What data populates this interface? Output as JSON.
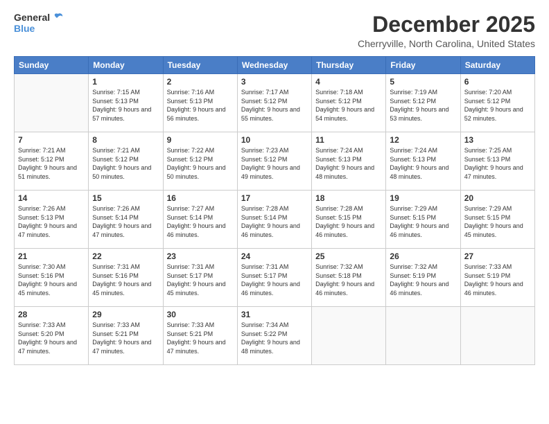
{
  "logo": {
    "general": "General",
    "blue": "Blue"
  },
  "title": {
    "month": "December 2025",
    "location": "Cherryville, North Carolina, United States"
  },
  "calendar": {
    "headers": [
      "Sunday",
      "Monday",
      "Tuesday",
      "Wednesday",
      "Thursday",
      "Friday",
      "Saturday"
    ],
    "weeks": [
      [
        {
          "day": "",
          "sunrise": "",
          "sunset": "",
          "daylight": ""
        },
        {
          "day": "1",
          "sunrise": "Sunrise: 7:15 AM",
          "sunset": "Sunset: 5:13 PM",
          "daylight": "Daylight: 9 hours and 57 minutes."
        },
        {
          "day": "2",
          "sunrise": "Sunrise: 7:16 AM",
          "sunset": "Sunset: 5:13 PM",
          "daylight": "Daylight: 9 hours and 56 minutes."
        },
        {
          "day": "3",
          "sunrise": "Sunrise: 7:17 AM",
          "sunset": "Sunset: 5:12 PM",
          "daylight": "Daylight: 9 hours and 55 minutes."
        },
        {
          "day": "4",
          "sunrise": "Sunrise: 7:18 AM",
          "sunset": "Sunset: 5:12 PM",
          "daylight": "Daylight: 9 hours and 54 minutes."
        },
        {
          "day": "5",
          "sunrise": "Sunrise: 7:19 AM",
          "sunset": "Sunset: 5:12 PM",
          "daylight": "Daylight: 9 hours and 53 minutes."
        },
        {
          "day": "6",
          "sunrise": "Sunrise: 7:20 AM",
          "sunset": "Sunset: 5:12 PM",
          "daylight": "Daylight: 9 hours and 52 minutes."
        }
      ],
      [
        {
          "day": "7",
          "sunrise": "Sunrise: 7:21 AM",
          "sunset": "Sunset: 5:12 PM",
          "daylight": "Daylight: 9 hours and 51 minutes."
        },
        {
          "day": "8",
          "sunrise": "Sunrise: 7:21 AM",
          "sunset": "Sunset: 5:12 PM",
          "daylight": "Daylight: 9 hours and 50 minutes."
        },
        {
          "day": "9",
          "sunrise": "Sunrise: 7:22 AM",
          "sunset": "Sunset: 5:12 PM",
          "daylight": "Daylight: 9 hours and 50 minutes."
        },
        {
          "day": "10",
          "sunrise": "Sunrise: 7:23 AM",
          "sunset": "Sunset: 5:12 PM",
          "daylight": "Daylight: 9 hours and 49 minutes."
        },
        {
          "day": "11",
          "sunrise": "Sunrise: 7:24 AM",
          "sunset": "Sunset: 5:13 PM",
          "daylight": "Daylight: 9 hours and 48 minutes."
        },
        {
          "day": "12",
          "sunrise": "Sunrise: 7:24 AM",
          "sunset": "Sunset: 5:13 PM",
          "daylight": "Daylight: 9 hours and 48 minutes."
        },
        {
          "day": "13",
          "sunrise": "Sunrise: 7:25 AM",
          "sunset": "Sunset: 5:13 PM",
          "daylight": "Daylight: 9 hours and 47 minutes."
        }
      ],
      [
        {
          "day": "14",
          "sunrise": "Sunrise: 7:26 AM",
          "sunset": "Sunset: 5:13 PM",
          "daylight": "Daylight: 9 hours and 47 minutes."
        },
        {
          "day": "15",
          "sunrise": "Sunrise: 7:26 AM",
          "sunset": "Sunset: 5:14 PM",
          "daylight": "Daylight: 9 hours and 47 minutes."
        },
        {
          "day": "16",
          "sunrise": "Sunrise: 7:27 AM",
          "sunset": "Sunset: 5:14 PM",
          "daylight": "Daylight: 9 hours and 46 minutes."
        },
        {
          "day": "17",
          "sunrise": "Sunrise: 7:28 AM",
          "sunset": "Sunset: 5:14 PM",
          "daylight": "Daylight: 9 hours and 46 minutes."
        },
        {
          "day": "18",
          "sunrise": "Sunrise: 7:28 AM",
          "sunset": "Sunset: 5:15 PM",
          "daylight": "Daylight: 9 hours and 46 minutes."
        },
        {
          "day": "19",
          "sunrise": "Sunrise: 7:29 AM",
          "sunset": "Sunset: 5:15 PM",
          "daylight": "Daylight: 9 hours and 46 minutes."
        },
        {
          "day": "20",
          "sunrise": "Sunrise: 7:29 AM",
          "sunset": "Sunset: 5:15 PM",
          "daylight": "Daylight: 9 hours and 45 minutes."
        }
      ],
      [
        {
          "day": "21",
          "sunrise": "Sunrise: 7:30 AM",
          "sunset": "Sunset: 5:16 PM",
          "daylight": "Daylight: 9 hours and 45 minutes."
        },
        {
          "day": "22",
          "sunrise": "Sunrise: 7:31 AM",
          "sunset": "Sunset: 5:16 PM",
          "daylight": "Daylight: 9 hours and 45 minutes."
        },
        {
          "day": "23",
          "sunrise": "Sunrise: 7:31 AM",
          "sunset": "Sunset: 5:17 PM",
          "daylight": "Daylight: 9 hours and 45 minutes."
        },
        {
          "day": "24",
          "sunrise": "Sunrise: 7:31 AM",
          "sunset": "Sunset: 5:17 PM",
          "daylight": "Daylight: 9 hours and 46 minutes."
        },
        {
          "day": "25",
          "sunrise": "Sunrise: 7:32 AM",
          "sunset": "Sunset: 5:18 PM",
          "daylight": "Daylight: 9 hours and 46 minutes."
        },
        {
          "day": "26",
          "sunrise": "Sunrise: 7:32 AM",
          "sunset": "Sunset: 5:19 PM",
          "daylight": "Daylight: 9 hours and 46 minutes."
        },
        {
          "day": "27",
          "sunrise": "Sunrise: 7:33 AM",
          "sunset": "Sunset: 5:19 PM",
          "daylight": "Daylight: 9 hours and 46 minutes."
        }
      ],
      [
        {
          "day": "28",
          "sunrise": "Sunrise: 7:33 AM",
          "sunset": "Sunset: 5:20 PM",
          "daylight": "Daylight: 9 hours and 47 minutes."
        },
        {
          "day": "29",
          "sunrise": "Sunrise: 7:33 AM",
          "sunset": "Sunset: 5:21 PM",
          "daylight": "Daylight: 9 hours and 47 minutes."
        },
        {
          "day": "30",
          "sunrise": "Sunrise: 7:33 AM",
          "sunset": "Sunset: 5:21 PM",
          "daylight": "Daylight: 9 hours and 47 minutes."
        },
        {
          "day": "31",
          "sunrise": "Sunrise: 7:34 AM",
          "sunset": "Sunset: 5:22 PM",
          "daylight": "Daylight: 9 hours and 48 minutes."
        },
        {
          "day": "",
          "sunrise": "",
          "sunset": "",
          "daylight": ""
        },
        {
          "day": "",
          "sunrise": "",
          "sunset": "",
          "daylight": ""
        },
        {
          "day": "",
          "sunrise": "",
          "sunset": "",
          "daylight": ""
        }
      ]
    ]
  }
}
